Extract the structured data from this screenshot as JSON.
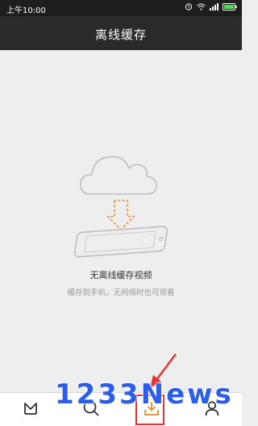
{
  "status_bar": {
    "time": "上午10:00",
    "icons": [
      "alarm-icon",
      "wifi-icon",
      "signal-icon",
      "battery-icon"
    ]
  },
  "header": {
    "title": "离线缓存"
  },
  "empty_state": {
    "illustration": "cloud-download-to-phone-icon",
    "title": "无离线缓存视频",
    "subtitle": "缓存到手机，无网络时也可观看"
  },
  "tab_bar": {
    "items": [
      {
        "icon": "home-m-icon"
      },
      {
        "icon": "search-icon"
      },
      {
        "icon": "download-icon",
        "active": true
      },
      {
        "icon": "user-icon"
      }
    ]
  },
  "watermark": "1233News",
  "colors": {
    "accent": "#f08a24",
    "header_bg": "#2a2a2a",
    "statusbar_bg": "#1e1e1e",
    "highlight": "#e8312e",
    "watermark": "#2c5ee8"
  }
}
